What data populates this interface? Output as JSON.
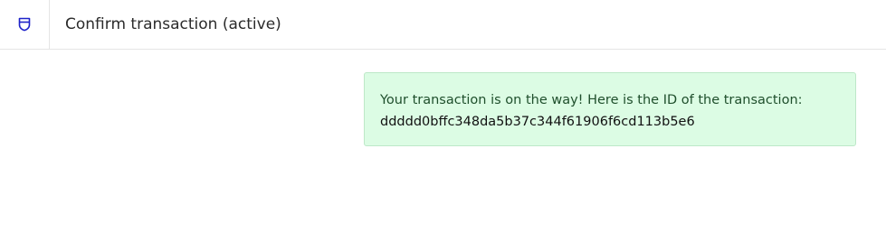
{
  "header": {
    "icon": "shield-icon",
    "title": "Confirm transaction (active)"
  },
  "alert": {
    "message": "Your transaction is on the way! Here is the ID of the transaction:",
    "transaction_id": "ddddd0bffc348da5b37c344f61906f6cd113b5e6"
  },
  "colors": {
    "accent": "#1e22c9",
    "alert_background": "#dcfce4",
    "alert_border": "#bde8c8",
    "alert_text": "#1f4f2c"
  }
}
